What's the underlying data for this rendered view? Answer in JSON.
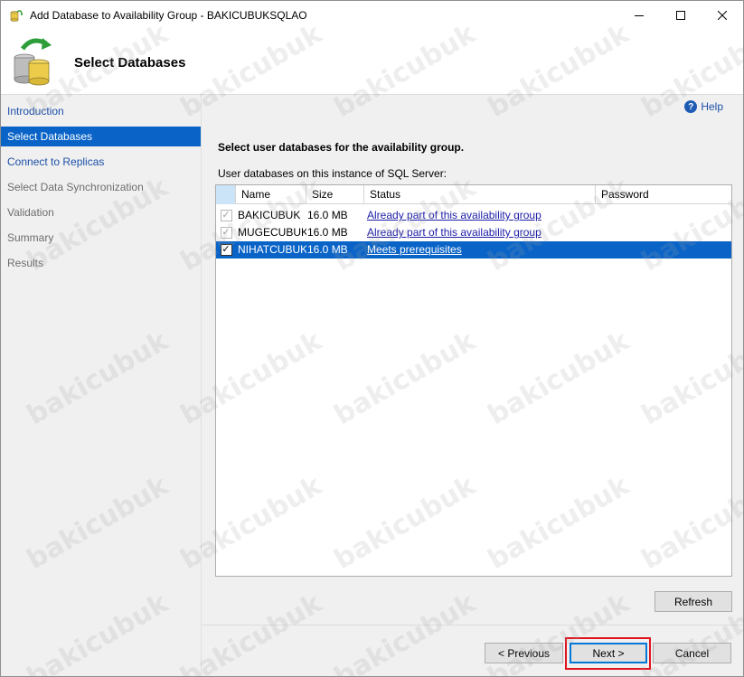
{
  "window": {
    "title": "Add Database to Availability Group - BAKICUBUKSQLAO"
  },
  "header": {
    "title": "Select Databases"
  },
  "nav": {
    "items": [
      {
        "label": "Introduction",
        "state": "link"
      },
      {
        "label": "Select Databases",
        "state": "active"
      },
      {
        "label": "Connect to Replicas",
        "state": "link"
      },
      {
        "label": "Select Data Synchronization",
        "state": "disabled"
      },
      {
        "label": "Validation",
        "state": "disabled"
      },
      {
        "label": "Summary",
        "state": "disabled"
      },
      {
        "label": "Results",
        "state": "disabled"
      }
    ]
  },
  "help": {
    "label": "Help"
  },
  "main": {
    "instruction": "Select user databases for the availability group.",
    "grid_label": "User databases on this instance of SQL Server:",
    "columns": [
      "Name",
      "Size",
      "Status",
      "Password"
    ],
    "rows": [
      {
        "name": "BAKICUBUK",
        "size": "16.0 MB",
        "status": "Already part of this availability group",
        "checked": true,
        "enabled": false
      },
      {
        "name": "MUGECUBUK",
        "size": "16.0 MB",
        "status": "Already part of this availability group",
        "checked": true,
        "enabled": false
      },
      {
        "name": "NIHATCUBUK",
        "size": "16.0 MB",
        "status": "Meets prerequisites",
        "checked": true,
        "enabled": true
      }
    ]
  },
  "buttons": {
    "refresh": "Refresh",
    "previous": "< Previous",
    "next": "Next >",
    "cancel": "Cancel"
  },
  "watermark": "bakicubuk",
  "colors": {
    "selection": "#0a64c8",
    "link": "#1c4fa8",
    "highlight_box": "#e0141e"
  }
}
